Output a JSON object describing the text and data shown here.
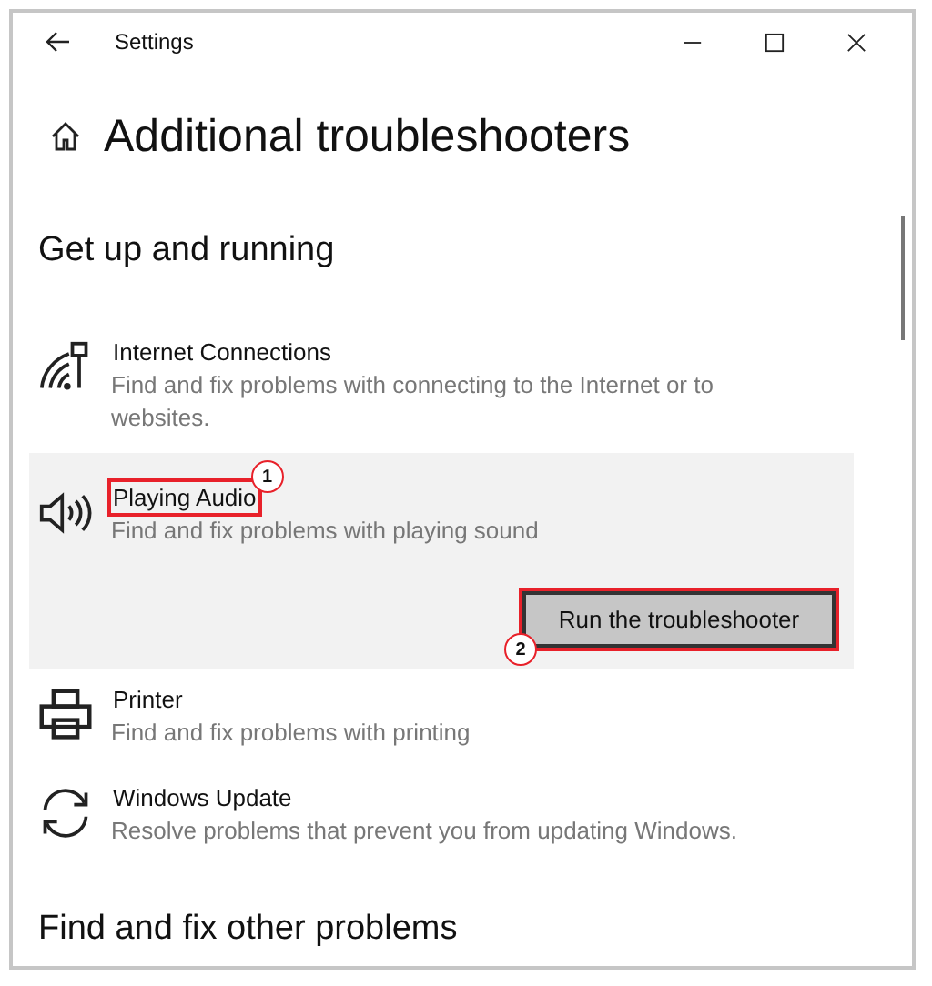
{
  "window": {
    "title": "Settings"
  },
  "page": {
    "heading": "Additional troubleshooters"
  },
  "sections": [
    {
      "heading": "Get up and running",
      "items": [
        {
          "kind": "network",
          "title": "Internet Connections",
          "description": "Find and fix problems with connecting to the Internet or to websites.",
          "expanded": false
        },
        {
          "kind": "speaker",
          "title": "Playing Audio",
          "description": "Find and fix problems with playing sound",
          "expanded": true,
          "button": "Run the troubleshooter",
          "title_callout": "1",
          "button_callout": "2"
        },
        {
          "kind": "printer",
          "title": "Printer",
          "description": "Find and fix problems with printing",
          "expanded": false
        },
        {
          "kind": "sync",
          "title": "Windows Update",
          "description": "Resolve problems that prevent you from updating Windows.",
          "expanded": false
        }
      ]
    },
    {
      "heading": "Find and fix other problems"
    }
  ]
}
